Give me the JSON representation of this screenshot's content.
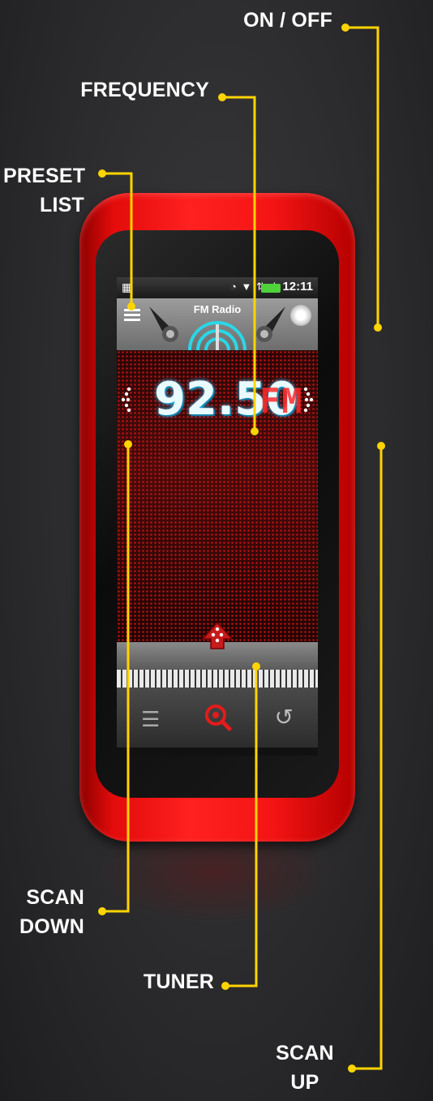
{
  "callouts": {
    "on_off": "ON / OFF",
    "frequency": "FREQUENCY",
    "preset_list_1": "PRESET",
    "preset_list_2": "LIST",
    "scan_down_1": "SCAN",
    "scan_down_2": "DOWN",
    "tuner": "TUNER",
    "scan_up_1": "SCAN",
    "scan_up_2": "UP"
  },
  "colors": {
    "callout_line": "#ffd400",
    "phone_body": "#e30b0b",
    "frequency_glow": "#2fc9ff",
    "band_text": "#ff2a2a"
  },
  "app": {
    "status_time": "12:11",
    "title": "FM Radio",
    "frequency": "92.50",
    "band": "FM"
  },
  "icons": {
    "menu": "menu-icon",
    "power": "power-icon",
    "scan_down": "scan-down-icon",
    "scan_up": "scan-up-icon",
    "tuner": "tuner-arrow-icon",
    "search": "search-icon",
    "back": "back-icon"
  }
}
